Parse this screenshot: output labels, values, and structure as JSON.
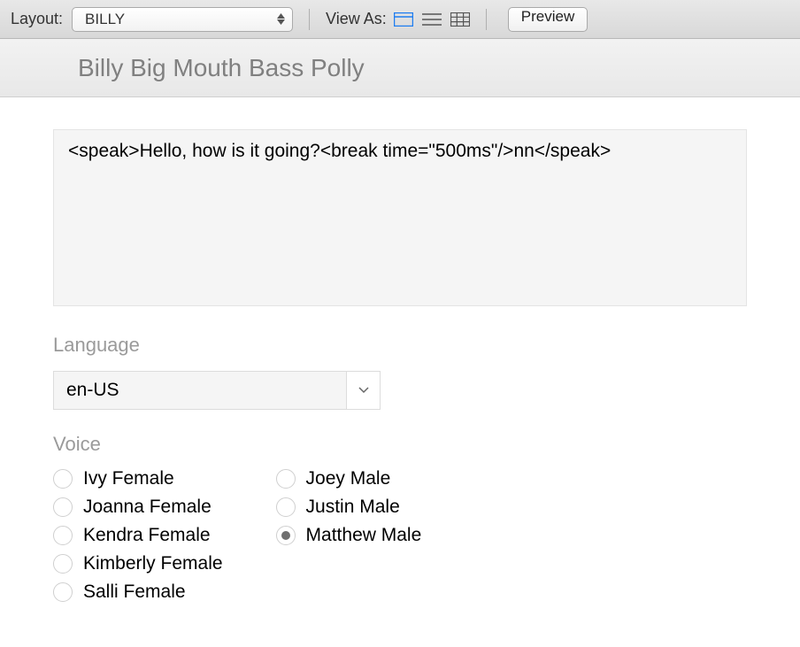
{
  "toolbar": {
    "layout_label": "Layout:",
    "layout_value": "BILLY",
    "view_as_label": "View As:",
    "preview_label": "Preview"
  },
  "page_title": "Billy Big Mouth Bass Polly",
  "ssml_text": "<speak>Hello, how is it going?<break time=\"500ms\"/>nn</speak>",
  "language": {
    "label": "Language",
    "value": "en-US"
  },
  "voice": {
    "label": "Voice",
    "selected": "Matthew Male",
    "left_column": [
      "Ivy Female",
      "Joanna Female",
      "Kendra Female",
      "Kimberly Female",
      "Salli Female"
    ],
    "right_column": [
      "Joey Male",
      "Justin Male",
      "Matthew Male"
    ]
  }
}
